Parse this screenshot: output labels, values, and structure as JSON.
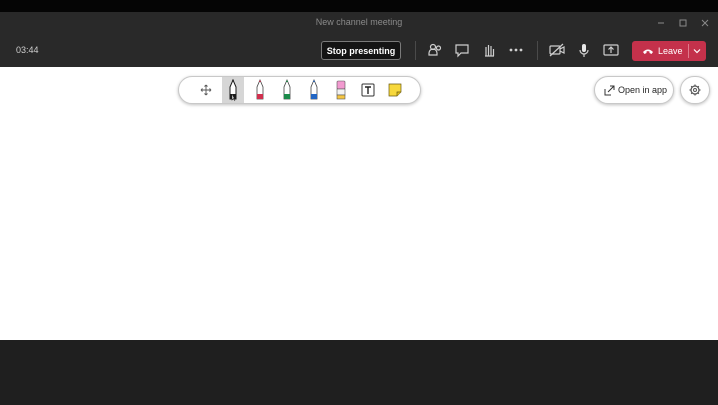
{
  "window": {
    "title": "New channel meeting"
  },
  "toolbar": {
    "timer": "03:44",
    "stop_presenting_label": "Stop presenting",
    "leave_label": "Leave",
    "leave_color": "#c4314b"
  },
  "whiteboard": {
    "tools": [
      {
        "name": "move",
        "icon": "move-icon"
      },
      {
        "name": "black-pen",
        "color": "#1a1a1a",
        "selected": true
      },
      {
        "name": "red-pen",
        "color": "#d0304e"
      },
      {
        "name": "green-pen",
        "color": "#1b8a4a"
      },
      {
        "name": "blue-pen",
        "color": "#2266c4"
      },
      {
        "name": "highlighter",
        "color": "#f29ad0"
      },
      {
        "name": "text",
        "icon": "text-box-icon"
      },
      {
        "name": "sticky-note",
        "color": "#f7d83c"
      }
    ],
    "open_in_app_label": "Open in app"
  }
}
